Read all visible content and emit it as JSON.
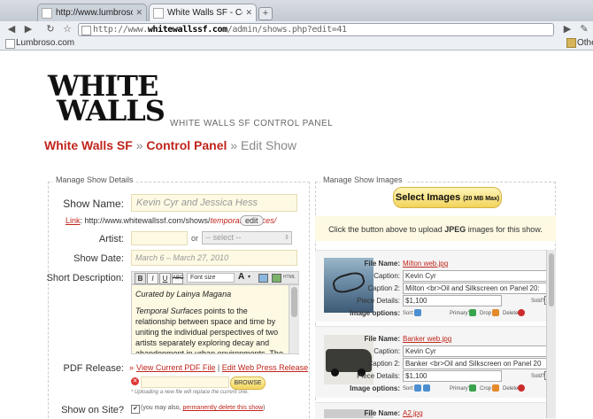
{
  "browser": {
    "tabs": [
      {
        "title": "http://www.lumbroso.com/t"
      },
      {
        "title": "White Walls SF - Control Panel"
      }
    ],
    "url_prefix": "http://www.",
    "url_domain": "whitewallssf.com",
    "url_path": "/admin/shows.php?edit=41",
    "bookmarks": [
      "Lumbroso.com"
    ],
    "other_bookmarks": "Other"
  },
  "header": {
    "logo_top": "WHITE",
    "logo_bottom": "WALLS",
    "panel_title": "WHITE WALLS SF CONTROL PANEL"
  },
  "breadcrumb": {
    "home": "White Walls SF",
    "sep": "»",
    "panel": "Control Panel",
    "current": "Edit Show"
  },
  "details": {
    "legend": "Manage Show Details",
    "show_name_label": "Show Name:",
    "show_name_value": "Kevin Cyr and Jessica Hess",
    "link_label": "Link",
    "link_base": ": http://www.whitewallssf.com/shows/",
    "link_slug": "temporal-surfaces/",
    "edit_button": "edit",
    "artist_label": "Artist:",
    "artist_or": "or",
    "artist_select": "-- select --",
    "date_label": "Show Date:",
    "date_value": "March 6 – March 27, 2010",
    "desc_label": "Short Description:",
    "rte_font_size": "Font size",
    "rte_html": "HTML",
    "desc_line1_a": "Curated by ",
    "desc_line1_b": "Lainya Magana",
    "desc_para_a": "Temporal Surfaces",
    "desc_para_b": " points to the relationship between space and time by uniting the individual perspectives of two artists separately exploring decay and abandonment in urban environments. The result is a body of work documenting the transitory nature of the contemporary urban",
    "pdf_label": "PDF Release:",
    "pdf_view": "View Current PDF File",
    "pdf_sep": "|",
    "pdf_edit": "Edit Web Press Release",
    "browse_button": "BROWSE",
    "upload_note": "* Uploading a new file will replace the current one.",
    "show_on_site_label": "Show on Site?",
    "show_on_site_text": "(you may also,",
    "show_on_site_delete": "permanently delete this show",
    "show_on_site_close": ")"
  },
  "images": {
    "legend": "Manage Show Images",
    "select_button": "Select Images",
    "select_max": "(20 MB Max)",
    "upload_note_a": "Click the button above to upload ",
    "upload_note_b": "JPEG",
    "upload_note_c": " images for this show.",
    "labels": {
      "file_name": "File Name:",
      "caption": "Caption:",
      "caption2": "Caption 2:",
      "piece_details": "Piece Details:",
      "sold": "Sold?",
      "image_options": "Image options:",
      "sort": "Sort:",
      "primary": "Primary?",
      "crop": "Crop",
      "delete": "Delete"
    },
    "items": [
      {
        "file": "Milton web.jpg",
        "caption": "Kevin Cyr",
        "caption2": "Milton <br>Oil and Silkscreen on Panel 20:",
        "price": "$1,100"
      },
      {
        "file": "Banker web.jpg",
        "caption": "Kevin Cyr",
        "caption2": "Banker <br>Oil and Silkscreen on Panel 20",
        "price": "$1,100"
      },
      {
        "file": "A2.jpg"
      }
    ]
  },
  "colors": {
    "accent_red": "#c0251c",
    "cream": "#fdf9e3"
  }
}
